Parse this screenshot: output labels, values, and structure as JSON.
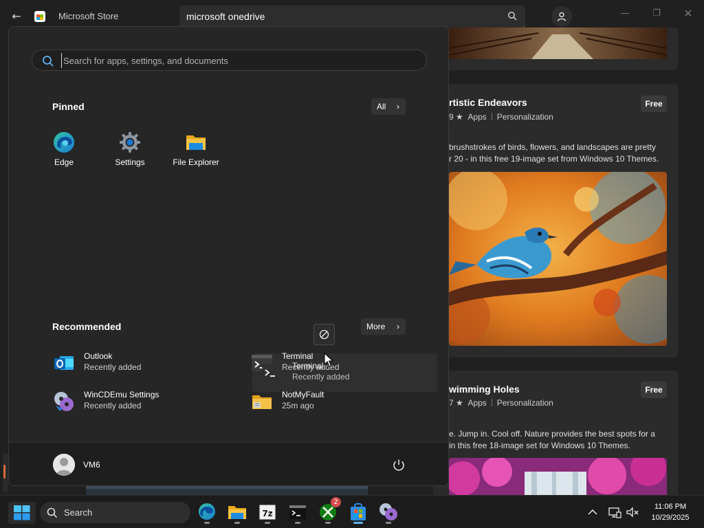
{
  "store": {
    "title": "Microsoft Store",
    "search_value": "microsoft onedrive",
    "cards": [
      {
        "title": "rtistic Endeavors",
        "rating": "9 ★",
        "category1": "Apps",
        "category2": "Personalization",
        "price": "Free",
        "desc_line1": "brushstrokes of birds, flowers, and landscapes are pretty",
        "desc_line2": "r 20 - in this free 19-image set from Windows 10 Themes."
      },
      {
        "title": "wimming Holes",
        "rating": "7 ★",
        "category1": "Apps",
        "category2": "Personalization",
        "price": "Free",
        "desc_line1": "e. Jump in. Cool off. Nature provides the best spots for a",
        "desc_line2": "in this free 18-image set for Windows 10 Themes."
      }
    ]
  },
  "start_menu": {
    "search_placeholder": "Search for apps, settings, and documents",
    "pinned_title": "Pinned",
    "all_label": "All",
    "pinned": [
      {
        "label": "Edge",
        "icon": "edge-icon"
      },
      {
        "label": "Settings",
        "icon": "settings-gear-icon"
      },
      {
        "label": "File Explorer",
        "icon": "folder-icon"
      }
    ],
    "recommended_title": "Recommended",
    "more_label": "More",
    "recommended": [
      {
        "name": "Outlook",
        "sub": "Recently added",
        "icon": "outlook-icon"
      },
      {
        "name": "Terminal",
        "sub": "Recently added",
        "icon": "terminal-icon"
      },
      {
        "name": "WinCDEmu Settings",
        "sub": "Recently added",
        "icon": "wincdemu-icon"
      },
      {
        "name": "NotMyFault",
        "sub": "25m ago",
        "icon": "folder-zip-icon"
      }
    ],
    "drag_ghost": {
      "name": "Terminal",
      "sub": "Recently added"
    },
    "user_name": "VM6"
  },
  "taskbar": {
    "search_label": "Search",
    "xbox_badge": "2",
    "time": "11:06 PM",
    "date": "10/29/2025"
  },
  "colors": {
    "accent": "#0078d4",
    "start_bg": "#262626",
    "taskbar_bg": "#1c1c1c"
  }
}
